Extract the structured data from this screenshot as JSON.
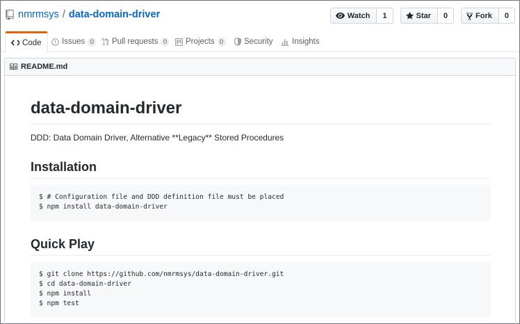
{
  "repo": {
    "owner": "nmrmsys",
    "separator": "/",
    "name": "data-domain-driver"
  },
  "actions": [
    {
      "label": "Watch",
      "count": "1",
      "icon": "eye-icon"
    },
    {
      "label": "Star",
      "count": "0",
      "icon": "star-icon"
    },
    {
      "label": "Fork",
      "count": "0",
      "icon": "fork-icon"
    }
  ],
  "tabs": [
    {
      "label": "Code",
      "icon": "code-icon",
      "selected": true
    },
    {
      "label": "Issues",
      "count": "0",
      "icon": "issue-icon"
    },
    {
      "label": "Pull requests",
      "count": "0",
      "icon": "pull-request-icon"
    },
    {
      "label": "Projects",
      "count": "0",
      "icon": "project-icon"
    },
    {
      "label": "Security",
      "icon": "shield-icon"
    },
    {
      "label": "Insights",
      "icon": "graph-icon"
    }
  ],
  "readme": {
    "filename": "README.md",
    "title": "data-domain-driver",
    "description": "DDD: Data Domain Driver, Alternative **Legacy** Stored Procedures",
    "sections": [
      {
        "heading": "Installation",
        "code": [
          "$ # Configuration file and DDD definition file must be placed",
          "$ npm install data-domain-driver"
        ]
      },
      {
        "heading": "Quick Play",
        "code": [
          "$ git clone https://github.com/nmrmsys/data-domain-driver.git",
          "$ cd data-domain-driver",
          "$ npm install",
          "$ npm test"
        ]
      }
    ]
  },
  "colors": {
    "link": "#0366d6",
    "tab_accent": "#e36209",
    "code_bg": "#f6f8fa"
  }
}
